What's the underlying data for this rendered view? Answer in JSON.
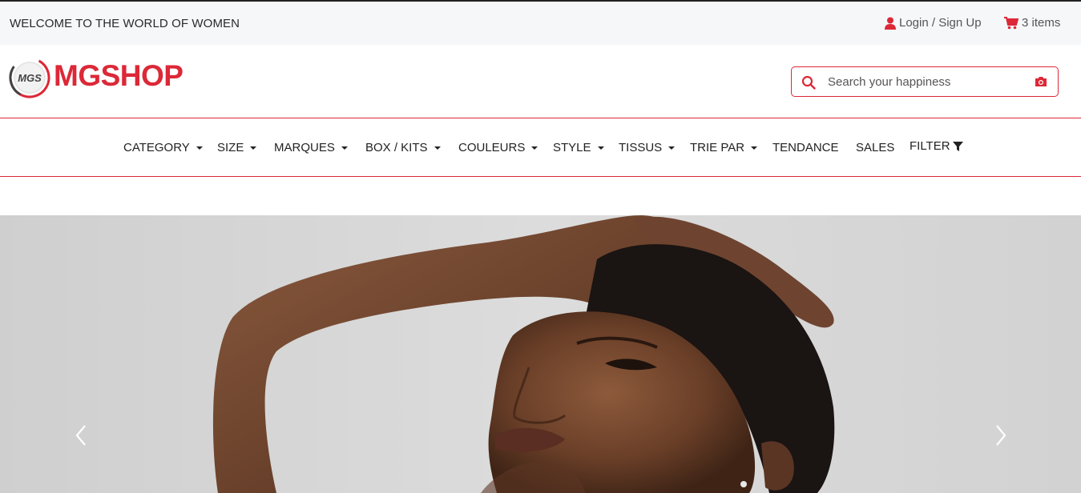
{
  "topbar": {
    "welcome_text": "WELCOME TO THE WORLD OF WOMEN",
    "login_label": "Login / Sign Up",
    "cart_label": "3 items"
  },
  "brand": {
    "badge_text": "MGS",
    "name": "MGSHOP",
    "color": "#dc2837"
  },
  "search": {
    "placeholder": "Search your happiness",
    "value": ""
  },
  "nav": {
    "items": [
      {
        "label": "CATEGORY",
        "dropdown": true
      },
      {
        "label": "SIZE",
        "dropdown": true
      },
      {
        "label": "MARQUES",
        "dropdown": true
      },
      {
        "label": "BOX / KITS",
        "dropdown": true
      },
      {
        "label": "COULEURS",
        "dropdown": true
      },
      {
        "label": "STYLE",
        "dropdown": true
      },
      {
        "label": "TISSUS",
        "dropdown": true
      },
      {
        "label": "TRIE PAR",
        "dropdown": true
      },
      {
        "label": "TENDANCE",
        "dropdown": false
      },
      {
        "label": "SALES",
        "dropdown": false
      },
      {
        "label": "FILTER",
        "dropdown": false,
        "icon": "filter-icon"
      }
    ]
  },
  "hero": {
    "image": "portrait-photo",
    "prev_icon": "chevron-left-icon",
    "next_icon": "chevron-right-icon"
  },
  "colors": {
    "accent": "#dc2837",
    "topbar_bg": "#f6f7f8",
    "hero_bg": "#d3d3d3"
  }
}
